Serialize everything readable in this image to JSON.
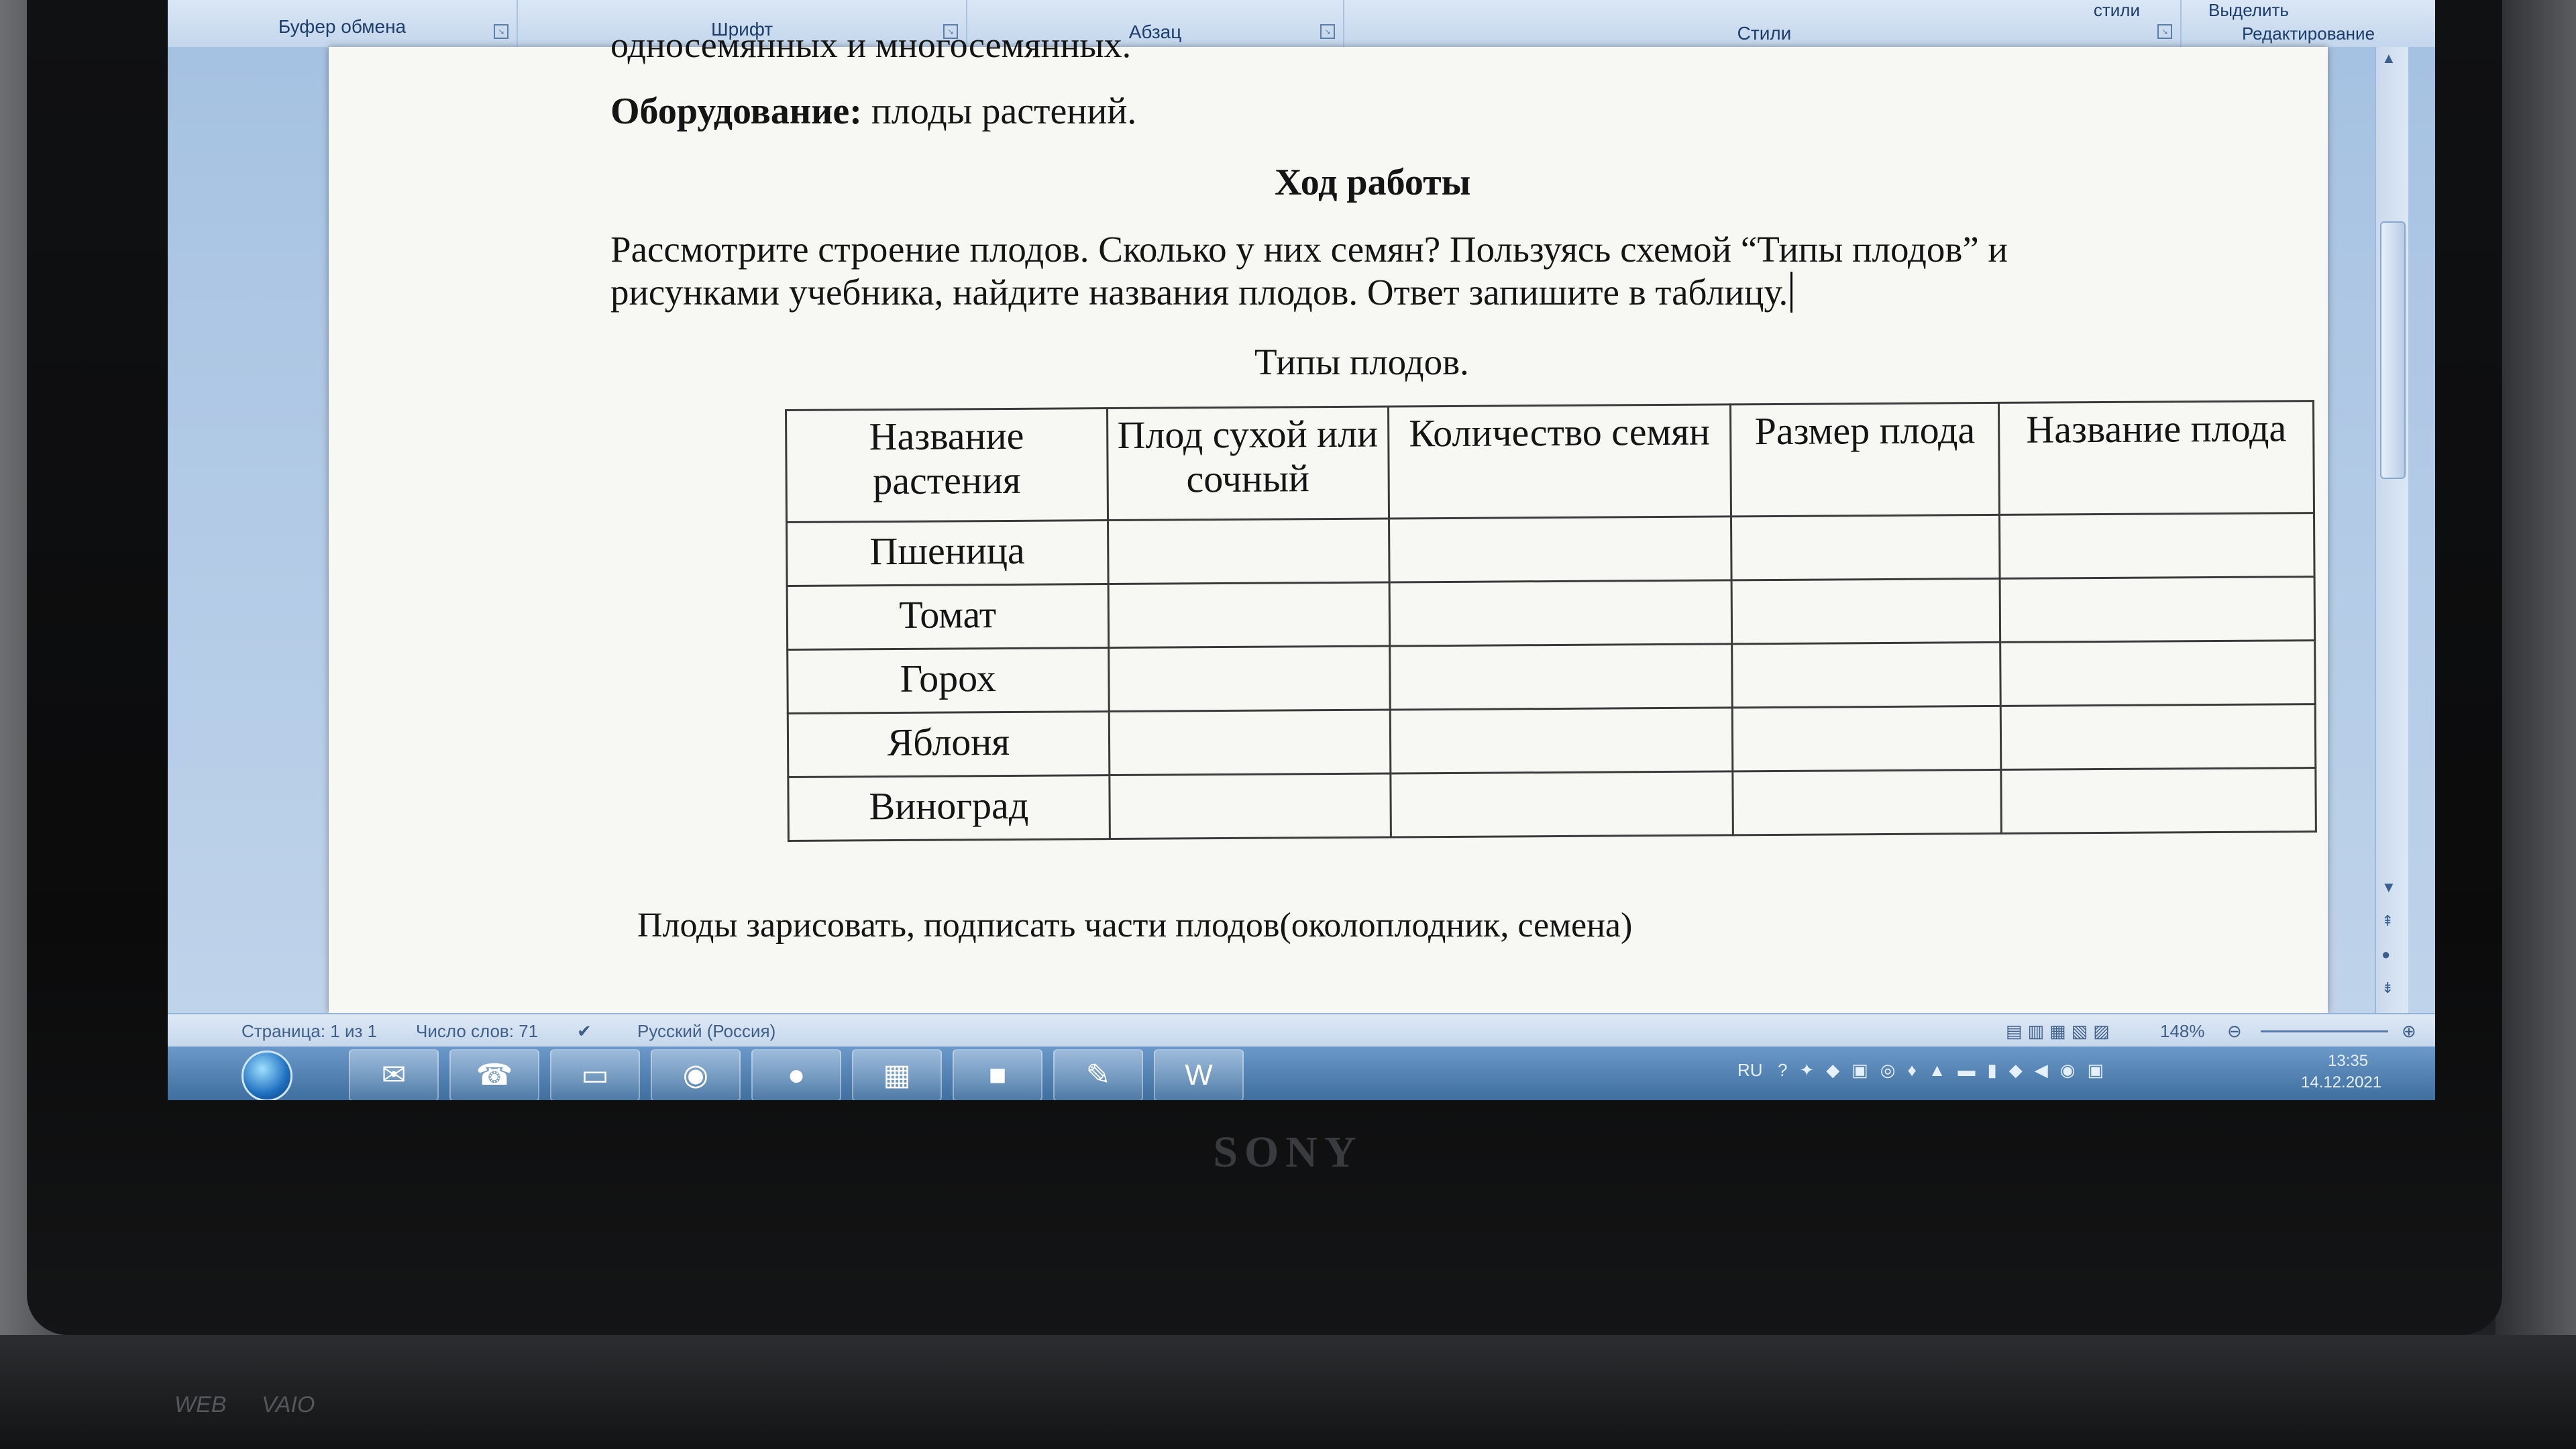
{
  "ribbon": {
    "groups": {
      "clipboard": "Буфер обмена",
      "font": "Шрифт",
      "paragraph": "Абзац",
      "styles": "Стили",
      "editing": "Редактирование"
    },
    "styles_button": "стили",
    "select_button": "Выделить"
  },
  "document": {
    "top_cut_text": "односемянных и многосемянных.",
    "equipment_label": "Оборудование:",
    "equipment_text": "плоды растений.",
    "work_heading": "Ход работы",
    "instruction_line1": "Рассмотрите строение плодов. Сколько у них семян? Пользуясь схемой “Типы плодов” и",
    "instruction_line2": "рисунками учебника, найдите названия плодов. Ответ запишите в таблицу.",
    "table_caption": "Типы плодов.",
    "table": {
      "headers": [
        "Название растения",
        "Плод сухой или сочный",
        "Количество семян",
        "Размер плода",
        "Название плода"
      ],
      "rows": [
        "Пшеница",
        "Томат",
        "Горох",
        "Яблоня",
        "Виноград"
      ]
    },
    "footer_text": "Плоды зарисовать, подписать части плодов(околоплодник, семена)"
  },
  "status_bar": {
    "page": "Страница: 1 из 1",
    "words": "Число слов: 71",
    "language": "Русский (Россия)",
    "zoom": "148%"
  },
  "taskbar": {
    "language": "RU",
    "time": "13:35",
    "date": "14.12.2021"
  },
  "device": {
    "brand": "SONY",
    "label_web": "WEB",
    "label_vaio": "VAIO"
  }
}
